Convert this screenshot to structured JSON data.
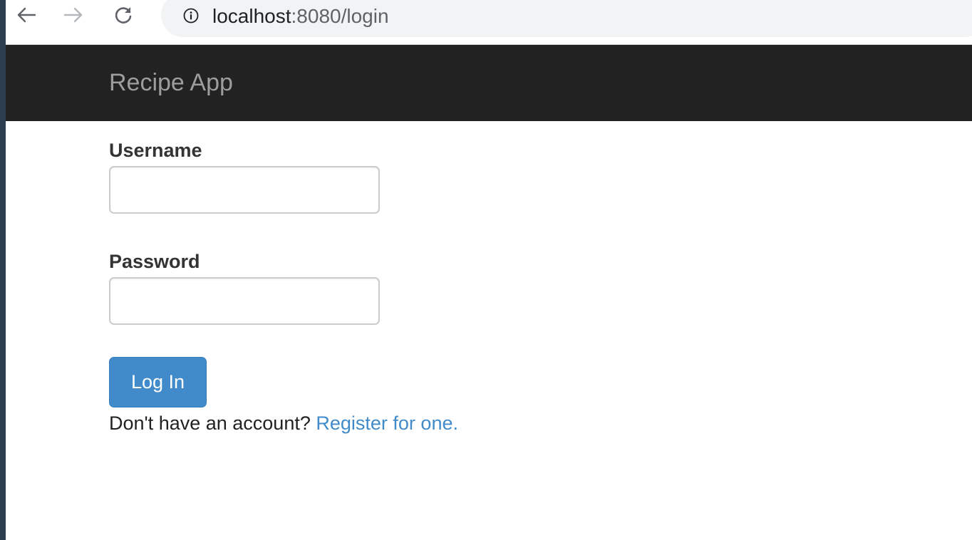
{
  "browser": {
    "url_host": "localhost",
    "url_rest": ":8080/login",
    "icons": {
      "back": "arrow-left-icon",
      "forward": "arrow-right-icon",
      "reload": "reload-icon",
      "site_info": "info-icon"
    }
  },
  "navbar": {
    "brand": "Recipe App",
    "background": "#222222",
    "brand_color": "#9d9d9d"
  },
  "form": {
    "username_label": "Username",
    "username_value": "",
    "password_label": "Password",
    "password_value": "",
    "submit_label": "Log In",
    "button_color": "#428bca"
  },
  "footer": {
    "prompt": "Don't have an account?",
    "register_link": "Register for one.",
    "link_color": "#428bca"
  }
}
